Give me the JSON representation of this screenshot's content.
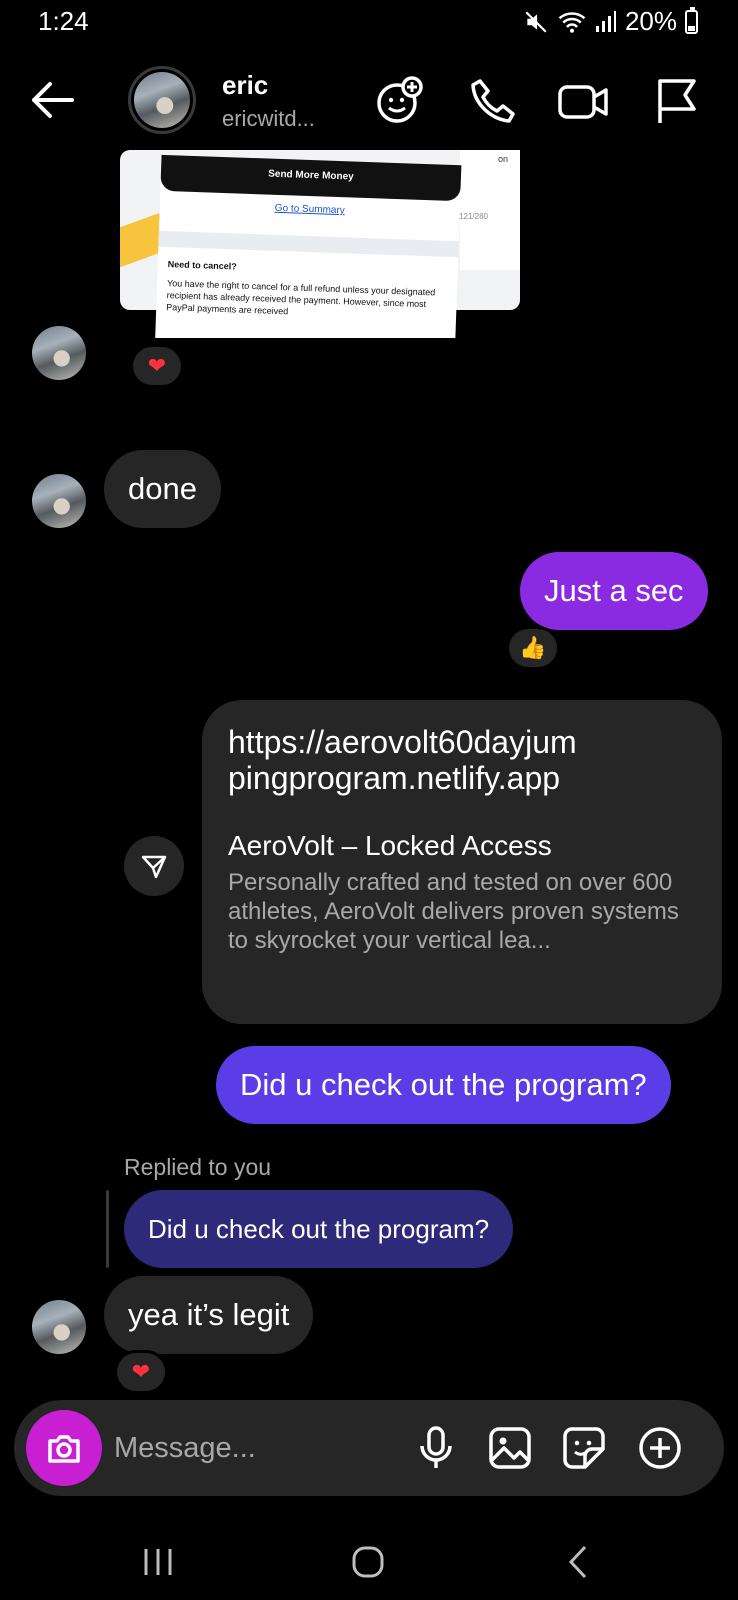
{
  "status_bar": {
    "time": "1:24",
    "battery": "20%"
  },
  "header": {
    "name": "eric",
    "handle": "ericwitd..."
  },
  "shared_image": {
    "card_title": "Send More Money",
    "link": "Go to Summary",
    "heading": "Need to cancel?",
    "body": "You have the right to cancel for a full refund unless your designated recipient has already received the payment. However, since most PayPal payments are received",
    "side_text": "on",
    "side_count": "121/280"
  },
  "messages": {
    "done": "done",
    "just_a_sec": "Just a sec",
    "thumbs_reaction": "👍",
    "link_url": "https://aerovolt60dayjumpingprogram.netlify.app",
    "link_title": "AeroVolt – Locked Access",
    "link_desc": "Personally crafted and tested on over 600 athletes, AeroVolt delivers proven systems to skyrocket your vertical lea...",
    "question": "Did u check out the program?",
    "replied_label": "Replied to you",
    "reply_quote": "Did u check out the program?",
    "legit": "yea it’s legit",
    "heart": "❤"
  },
  "composer": {
    "placeholder": "Message..."
  },
  "colors": {
    "outgoing_purple": "#8a2be2",
    "outgoing_indigo": "#5b3de8",
    "incoming": "#262626",
    "camera_button": "#c71fd1"
  }
}
